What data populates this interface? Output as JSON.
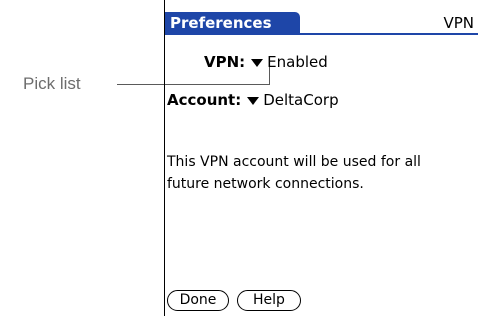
{
  "callout": {
    "label": "Pick list"
  },
  "titlebar": {
    "title": "Preferences",
    "right_label": "VPN"
  },
  "vpn": {
    "label": "VPN:",
    "value": "Enabled"
  },
  "account": {
    "label": "Account:",
    "value": "DeltaCorp"
  },
  "message": {
    "text": "This VPN account will be used for all future network connections."
  },
  "buttons": {
    "done": "Done",
    "help": "Help"
  },
  "icons": {
    "pick_list": "pick-list-triangle-icon"
  },
  "colors": {
    "title_bar": "#1e46a8",
    "callout_text": "#6d6d6d"
  }
}
